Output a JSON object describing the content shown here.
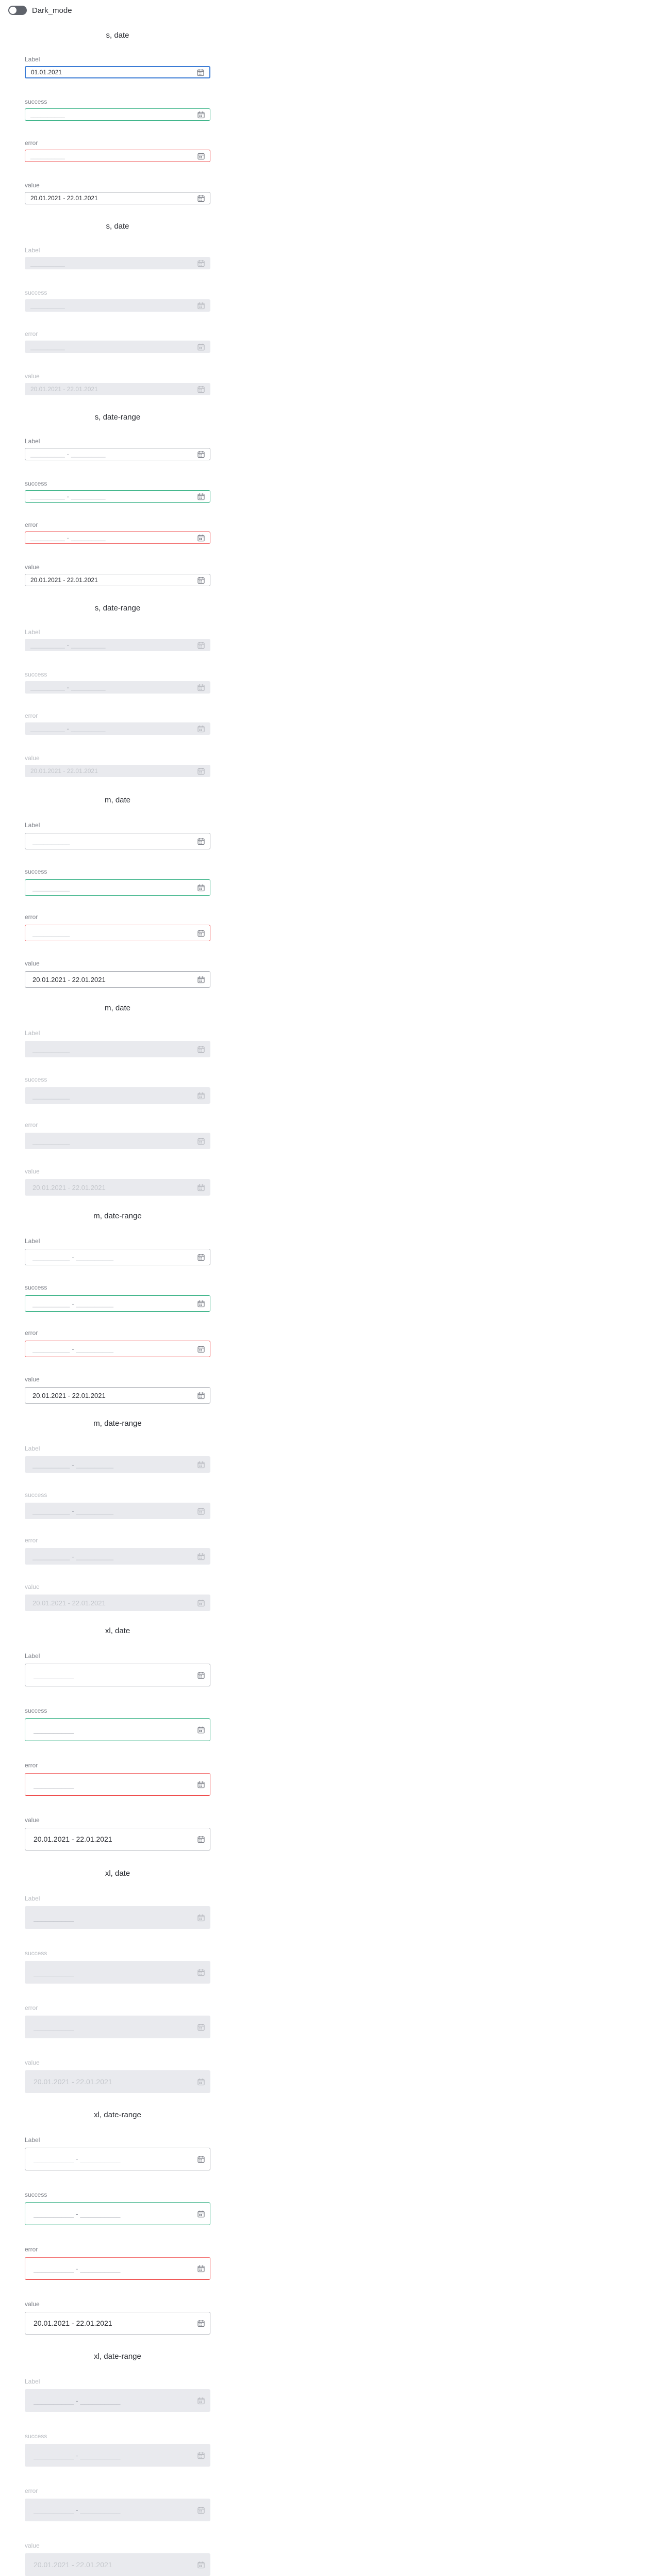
{
  "toggle": {
    "label": "Dark_mode",
    "on": false
  },
  "placeholder": "__________",
  "range_separator": "-",
  "sections": [
    {
      "title": "s, date",
      "size": "s",
      "kind": "date",
      "disabled": false,
      "fields": [
        {
          "label": "Label",
          "state": "focus",
          "value": "01.01.2021"
        },
        {
          "label": "success",
          "state": "success",
          "value": ""
        },
        {
          "label": "error",
          "state": "error",
          "value": ""
        },
        {
          "label": "value",
          "state": "default",
          "value": "20.01.2021 - 22.01.2021"
        }
      ]
    },
    {
      "title": "s, date",
      "size": "s",
      "kind": "date",
      "disabled": true,
      "fields": [
        {
          "label": "Label",
          "state": "disabled",
          "value": ""
        },
        {
          "label": "success",
          "state": "disabled",
          "value": ""
        },
        {
          "label": "error",
          "state": "disabled",
          "value": ""
        },
        {
          "label": "value",
          "state": "disabled",
          "value": "20.01.2021 - 22.01.2021"
        }
      ]
    },
    {
      "title": "s, date-range",
      "size": "s",
      "kind": "range",
      "disabled": false,
      "fields": [
        {
          "label": "Label",
          "state": "default",
          "value": ""
        },
        {
          "label": "success",
          "state": "success",
          "value": ""
        },
        {
          "label": "error",
          "state": "error",
          "value": ""
        },
        {
          "label": "value",
          "state": "default",
          "value": "20.01.2021 - 22.01.2021"
        }
      ]
    },
    {
      "title": "s, date-range",
      "size": "s",
      "kind": "range",
      "disabled": true,
      "fields": [
        {
          "label": "Label",
          "state": "disabled",
          "value": ""
        },
        {
          "label": "success",
          "state": "disabled",
          "value": ""
        },
        {
          "label": "error",
          "state": "disabled",
          "value": ""
        },
        {
          "label": "value",
          "state": "disabled",
          "value": "20.01.2021 - 22.01.2021"
        }
      ]
    },
    {
      "title": "m, date",
      "size": "m",
      "kind": "date",
      "disabled": false,
      "fields": [
        {
          "label": "Label",
          "state": "default",
          "value": ""
        },
        {
          "label": "success",
          "state": "success",
          "value": ""
        },
        {
          "label": "error",
          "state": "error",
          "value": ""
        },
        {
          "label": "value",
          "state": "default",
          "value": "20.01.2021 - 22.01.2021"
        }
      ]
    },
    {
      "title": "m, date",
      "size": "m",
      "kind": "date",
      "disabled": true,
      "fields": [
        {
          "label": "Label",
          "state": "disabled",
          "value": ""
        },
        {
          "label": "success",
          "state": "disabled",
          "value": ""
        },
        {
          "label": "error",
          "state": "disabled",
          "value": ""
        },
        {
          "label": "value",
          "state": "disabled",
          "value": "20.01.2021 - 22.01.2021"
        }
      ]
    },
    {
      "title": "m, date-range",
      "size": "m",
      "kind": "range",
      "disabled": false,
      "fields": [
        {
          "label": "Label",
          "state": "default",
          "value": ""
        },
        {
          "label": "success",
          "state": "success",
          "value": ""
        },
        {
          "label": "error",
          "state": "error",
          "value": ""
        },
        {
          "label": "value",
          "state": "default",
          "value": "20.01.2021 - 22.01.2021"
        }
      ]
    },
    {
      "title": "m, date-range",
      "size": "m",
      "kind": "range",
      "disabled": true,
      "fields": [
        {
          "label": "Label",
          "state": "disabled",
          "value": ""
        },
        {
          "label": "success",
          "state": "disabled",
          "value": ""
        },
        {
          "label": "error",
          "state": "disabled",
          "value": ""
        },
        {
          "label": "value",
          "state": "disabled",
          "value": "20.01.2021 - 22.01.2021"
        }
      ]
    },
    {
      "title": "xl, date",
      "size": "xl",
      "kind": "date",
      "disabled": false,
      "fields": [
        {
          "label": "Label",
          "state": "default",
          "value": ""
        },
        {
          "label": "success",
          "state": "success",
          "value": ""
        },
        {
          "label": "error",
          "state": "error",
          "value": ""
        },
        {
          "label": "value",
          "state": "default",
          "value": "20.01.2021 - 22.01.2021"
        }
      ]
    },
    {
      "title": "xl, date",
      "size": "xl",
      "kind": "date",
      "disabled": true,
      "fields": [
        {
          "label": "Label",
          "state": "disabled",
          "value": ""
        },
        {
          "label": "success",
          "state": "disabled",
          "value": ""
        },
        {
          "label": "error",
          "state": "disabled",
          "value": ""
        },
        {
          "label": "value",
          "state": "disabled",
          "value": "20.01.2021 - 22.01.2021"
        }
      ]
    },
    {
      "title": "xl, date-range",
      "size": "xl",
      "kind": "range",
      "disabled": false,
      "fields": [
        {
          "label": "Label",
          "state": "default",
          "value": ""
        },
        {
          "label": "success",
          "state": "success",
          "value": ""
        },
        {
          "label": "error",
          "state": "error",
          "value": ""
        },
        {
          "label": "value",
          "state": "default",
          "value": "20.01.2021 - 22.01.2021"
        }
      ]
    },
    {
      "title": "xl, date-range",
      "size": "xl",
      "kind": "range",
      "disabled": true,
      "fields": [
        {
          "label": "Label",
          "state": "disabled",
          "value": ""
        },
        {
          "label": "success",
          "state": "disabled",
          "value": ""
        },
        {
          "label": "error",
          "state": "disabled",
          "value": ""
        },
        {
          "label": "value",
          "state": "disabled",
          "value": "20.01.2021 - 22.01.2021"
        }
      ]
    }
  ],
  "colors": {
    "focus": "#3a7bd5",
    "success": "#3fb58a",
    "error": "#ef4a4a",
    "disabled_bg": "#e9eaee",
    "toggle_off": "#5f636b"
  },
  "icons": {
    "toggle": "toggle-switch",
    "field_button": "calendar-icon"
  }
}
